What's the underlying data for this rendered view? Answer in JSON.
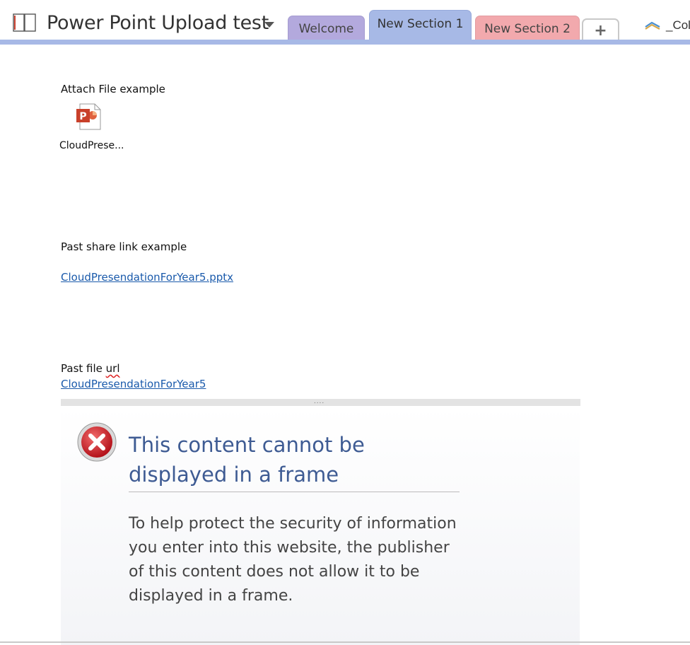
{
  "header": {
    "notebook_title": "Power Point Upload test",
    "tabs": [
      {
        "label": "Welcome",
        "color": "#b3a9dd"
      },
      {
        "label": "New Section 1",
        "color": "#a7b9e6",
        "active": true
      },
      {
        "label": "New Section 2",
        "color": "#f2a9ad"
      }
    ],
    "add_tab_label": "+",
    "collab_label": "_Coll"
  },
  "page": {
    "attach_label": "Attach File example",
    "attached_file_name": "CloudPrese...",
    "attached_file_icon": "powerpoint-file-icon",
    "share_label": "Past share link example",
    "share_link_text": "CloudPresendationForYear5.pptx",
    "fileurl_label_prefix": "Past file ",
    "fileurl_label_word": "url",
    "fileurl_link_text": "CloudPresendationForYear5",
    "frame_grip": "....",
    "frame": {
      "error_title": "This content cannot be displayed in a frame",
      "error_body": "To help protect the security of information you enter into this website, the publisher of this content does not allow it to be displayed in a frame.",
      "error_icon": "error-x-icon"
    }
  }
}
